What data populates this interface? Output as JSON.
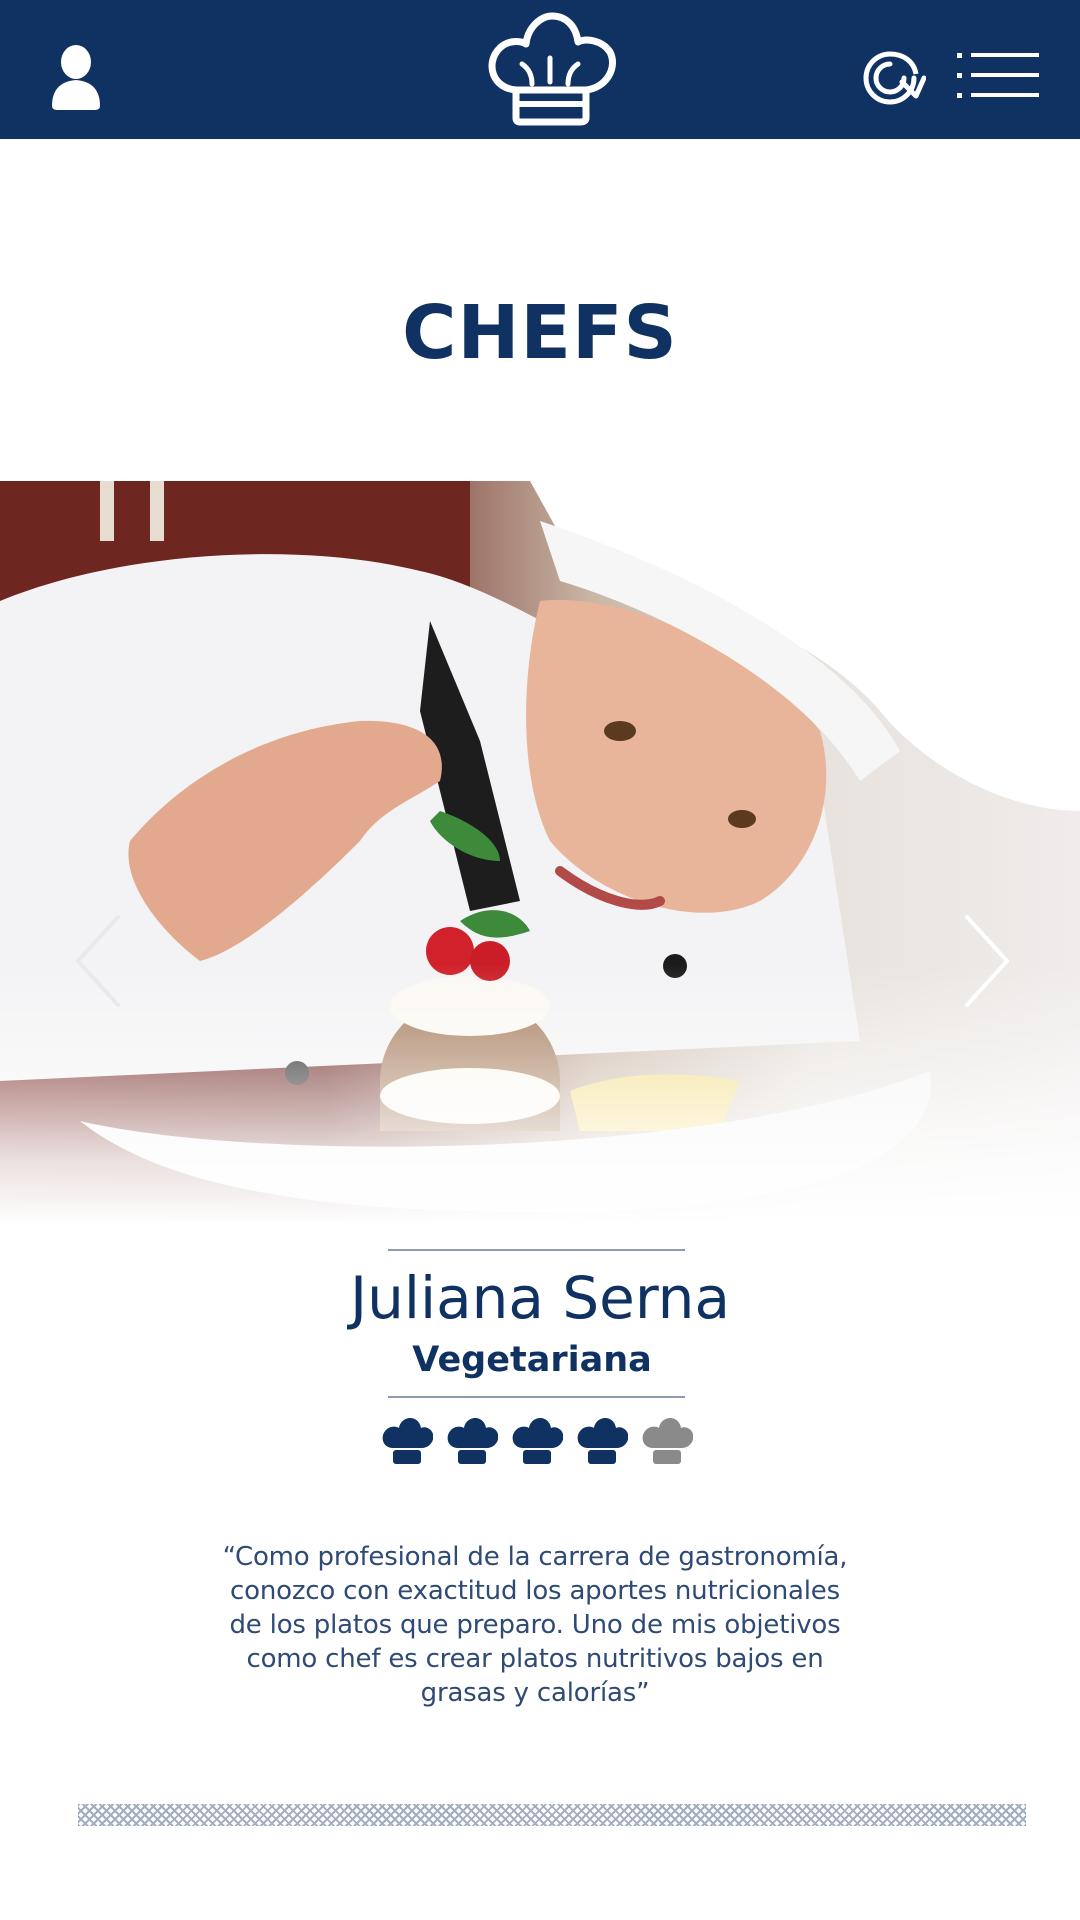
{
  "header": {
    "icons": {
      "user": "user-icon",
      "logo": "chef-hat-logo-icon",
      "refresh": "refresh-icon",
      "menu": "menu-list-icon"
    }
  },
  "page": {
    "title": "CHEFS"
  },
  "carousel": {
    "prev_icon": "chevron-left-icon",
    "next_icon": "chevron-right-icon"
  },
  "chef": {
    "name": "Juliana Serna",
    "specialty": "Vegetariana",
    "rating": {
      "value": 4,
      "max": 5,
      "icon": "chef-hat-icon"
    },
    "quote": "“Como profesional de la carrera de gastronomía, conozco con exactitud los aportes nutricionales de los platos que preparo. Uno de mis objetivos como chef es crear platos nutritivos bajos en grasas y calorías”"
  },
  "colors": {
    "primary": "#103262",
    "rating_active": "#103262",
    "rating_inactive": "#8a8a8a",
    "text_secondary": "#2f4a75"
  }
}
